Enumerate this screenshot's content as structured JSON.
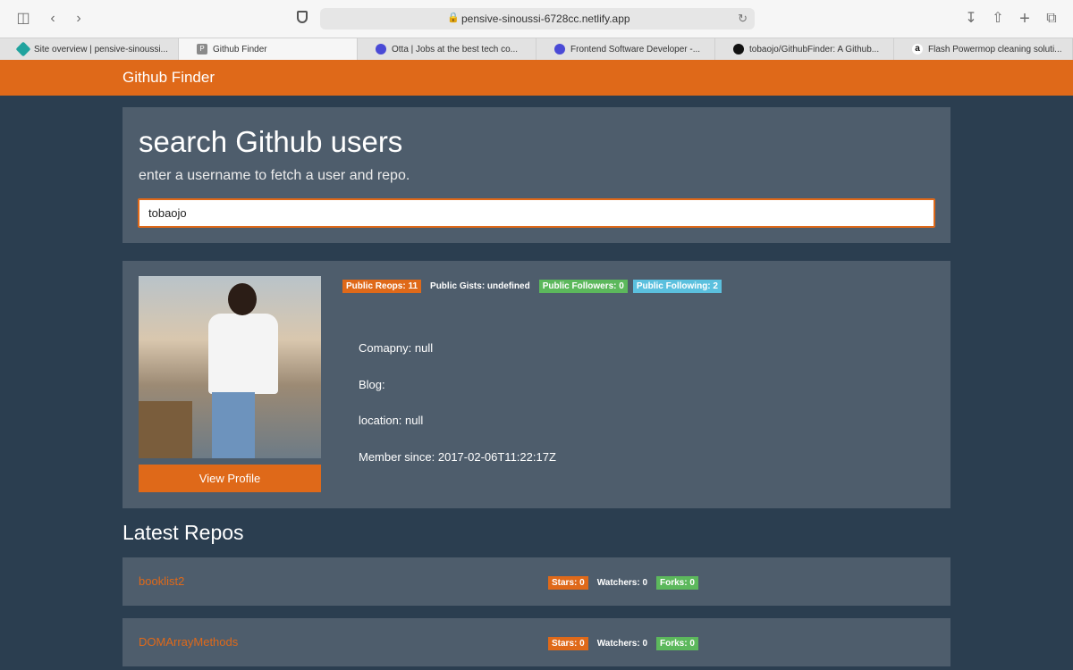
{
  "browser": {
    "url": "pensive-sinoussi-6728cc.netlify.app",
    "tabs": [
      {
        "title": "Site overview | pensive-sinoussi...",
        "active": false,
        "favicon_color": "#20a39e"
      },
      {
        "title": "Github Finder",
        "active": true,
        "favicon_color": "#8a8a8a",
        "favicon_letter": "P"
      },
      {
        "title": "Otta | Jobs at the best tech co...",
        "active": false,
        "favicon_color": "#4a4ad6"
      },
      {
        "title": "Frontend Software Developer -...",
        "active": false,
        "favicon_color": "#4a4ad6"
      },
      {
        "title": "tobaojo/GithubFinder: A Github...",
        "active": false,
        "favicon_color": "#111111"
      },
      {
        "title": "Flash Powermop cleaning soluti...",
        "active": false,
        "favicon_color": "#111111",
        "favicon_letter": "a"
      }
    ]
  },
  "navbar": {
    "brand": "Github Finder"
  },
  "search": {
    "title": "search Github users",
    "subtitle": "enter a username to fetch a user and repo.",
    "value": "tobaojo"
  },
  "profile": {
    "view_button": "View Profile",
    "badges": {
      "repos": "Public Reops: 11",
      "gists": "Public Gists: undefined",
      "followers": "Public Followers: 0",
      "following": "Public Following: 2"
    },
    "company": "Comapny: null",
    "blog": "Blog:",
    "location": "location: null",
    "member_since": "Member since: 2017-02-06T11:22:17Z"
  },
  "repos_section": {
    "title": "Latest Repos"
  },
  "repos": [
    {
      "name": "booklist2",
      "stars": "Stars: 0",
      "watchers": "Watchers: 0",
      "forks": "Forks: 0"
    },
    {
      "name": "DOMArrayMethods",
      "stars": "Stars: 0",
      "watchers": "Watchers: 0",
      "forks": "Forks: 0"
    }
  ],
  "colors": {
    "accent": "#df6919",
    "background": "#2b3e50",
    "card": "#4e5d6c",
    "success": "#5cb85c",
    "info": "#5bc0de"
  },
  "icons": [
    "sidebar-toggle-icon",
    "back-icon",
    "forward-icon",
    "shield-icon",
    "lock-icon",
    "reload-icon",
    "download-icon",
    "share-icon",
    "new-tab-icon",
    "tab-overview-icon"
  ]
}
